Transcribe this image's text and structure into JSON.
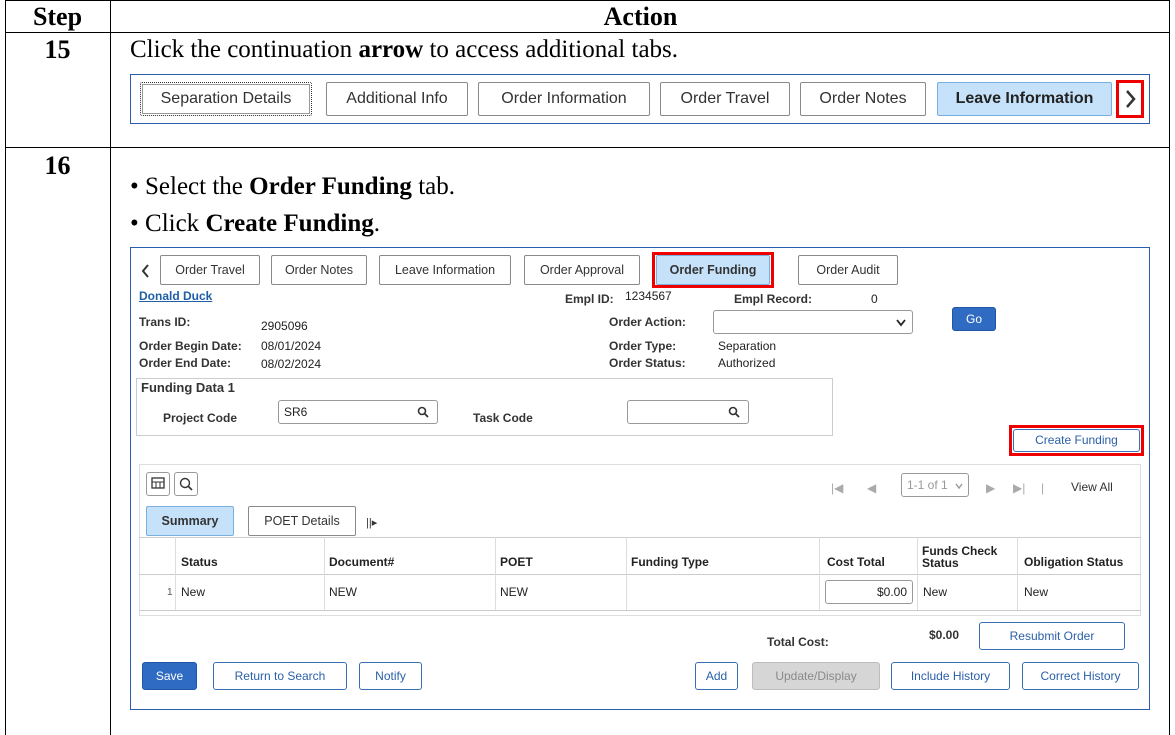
{
  "table": {
    "step_header": "Step",
    "action_header": "Action"
  },
  "step15": {
    "number": "15",
    "instr_pre": "Click the continuation ",
    "instr_bold": "arrow",
    "instr_post": " to access additional tabs.",
    "tabs": [
      "Separation Details",
      "Additional Info",
      "Order Information",
      "Order Travel",
      "Order Notes",
      "Leave Information"
    ],
    "active_tab": "Leave Information"
  },
  "step16": {
    "number": "16",
    "bullet1_pre": "Select the ",
    "bullet1_bold": "Order Funding",
    "bullet1_post": " tab.",
    "bullet2_pre": "Click ",
    "bullet2_bold": "Create Funding",
    "bullet2_post": ".",
    "tabs": [
      "Order Travel",
      "Order Notes",
      "Leave Information",
      "Order Approval",
      "Order Funding",
      "Order Audit"
    ],
    "active_tab": "Order Funding"
  },
  "form": {
    "employee_name": "Donald Duck",
    "empl_id_label": "Empl ID:",
    "empl_id": "1234567",
    "empl_record_label": "Empl Record:",
    "empl_record": "0",
    "trans_id_label": "Trans ID:",
    "trans_id": "2905096",
    "order_action_label": "Order Action:",
    "order_action_value": "",
    "go_label": "Go",
    "begin_label": "Order Begin Date:",
    "begin_date": "08/01/2024",
    "end_label": "Order End Date:",
    "end_date": "08/02/2024",
    "type_label": "Order Type:",
    "type_value": "Separation",
    "status_label": "Order Status:",
    "status_value": "Authorized",
    "funding_group_title": "Funding Data 1",
    "project_code_label": "Project Code",
    "project_code_value": "SR6",
    "task_code_label": "Task Code",
    "task_code_value": "",
    "create_funding_label": "Create Funding"
  },
  "grid": {
    "pager_text": "1-1 of 1",
    "view_all": "View All",
    "tabs": [
      "Summary",
      "POET Details"
    ],
    "active_tab": "Summary",
    "columns": [
      "Status",
      "Document#",
      "POET",
      "Funding Type",
      "Cost Total",
      "Funds Check Status",
      "Obligation Status"
    ],
    "rows": [
      {
        "row_num": "1",
        "status": "New",
        "document": "NEW",
        "poet": "NEW",
        "funding_type": "",
        "cost_total": "$0.00",
        "funds_check": "New",
        "obligation": "New"
      }
    ]
  },
  "footer": {
    "total_cost_label": "Total Cost:",
    "total_cost_value": "$0.00",
    "resubmit": "Resubmit Order",
    "buttons_left": [
      "Save",
      "Return to Search",
      "Notify"
    ],
    "buttons_right": [
      "Add",
      "Update/Display",
      "Include History",
      "Correct History"
    ]
  },
  "highlight_color": "#e00000",
  "accent_color": "#2f6bc2"
}
